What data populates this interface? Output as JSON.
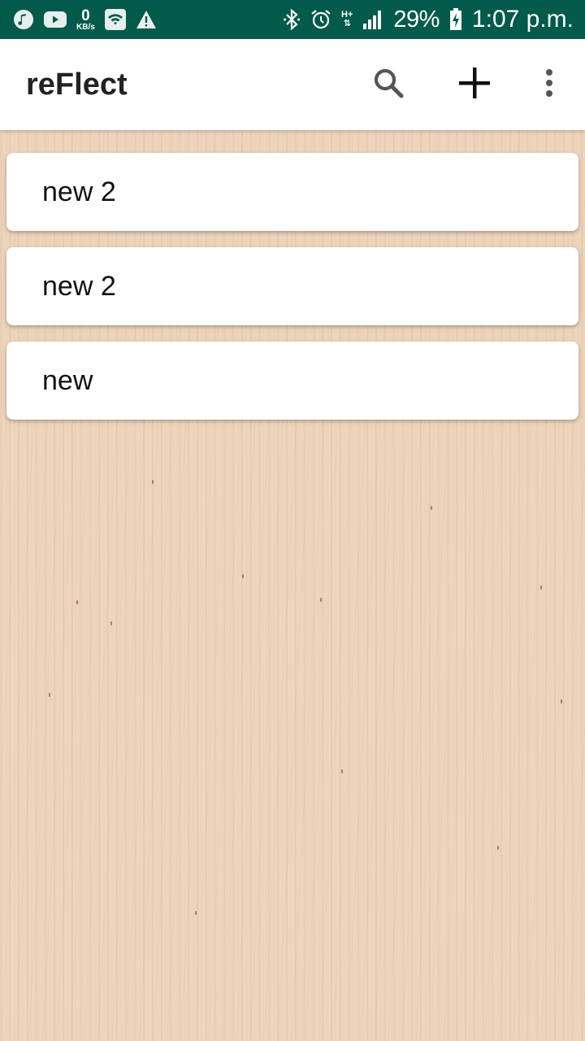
{
  "status_bar": {
    "net_speed_value": "0",
    "net_speed_unit": "KB/s",
    "network_type": "H+",
    "battery_percent": "29%",
    "time": "1:07 p.m.",
    "background_color": "#025a4a",
    "icons": [
      "music-note-icon",
      "youtube-icon",
      "wifi-box-icon",
      "warning-icon",
      "bluetooth-icon",
      "alarm-icon",
      "signal-icon",
      "battery-charging-icon"
    ]
  },
  "app_bar": {
    "title": "reFlect",
    "actions": [
      "search-icon",
      "add-icon",
      "more-vert-icon"
    ]
  },
  "notes": [
    {
      "title": "new 2"
    },
    {
      "title": "new 2"
    },
    {
      "title": "new"
    }
  ],
  "theme": {
    "background": "#ecd3b9",
    "card": "#ffffff"
  }
}
